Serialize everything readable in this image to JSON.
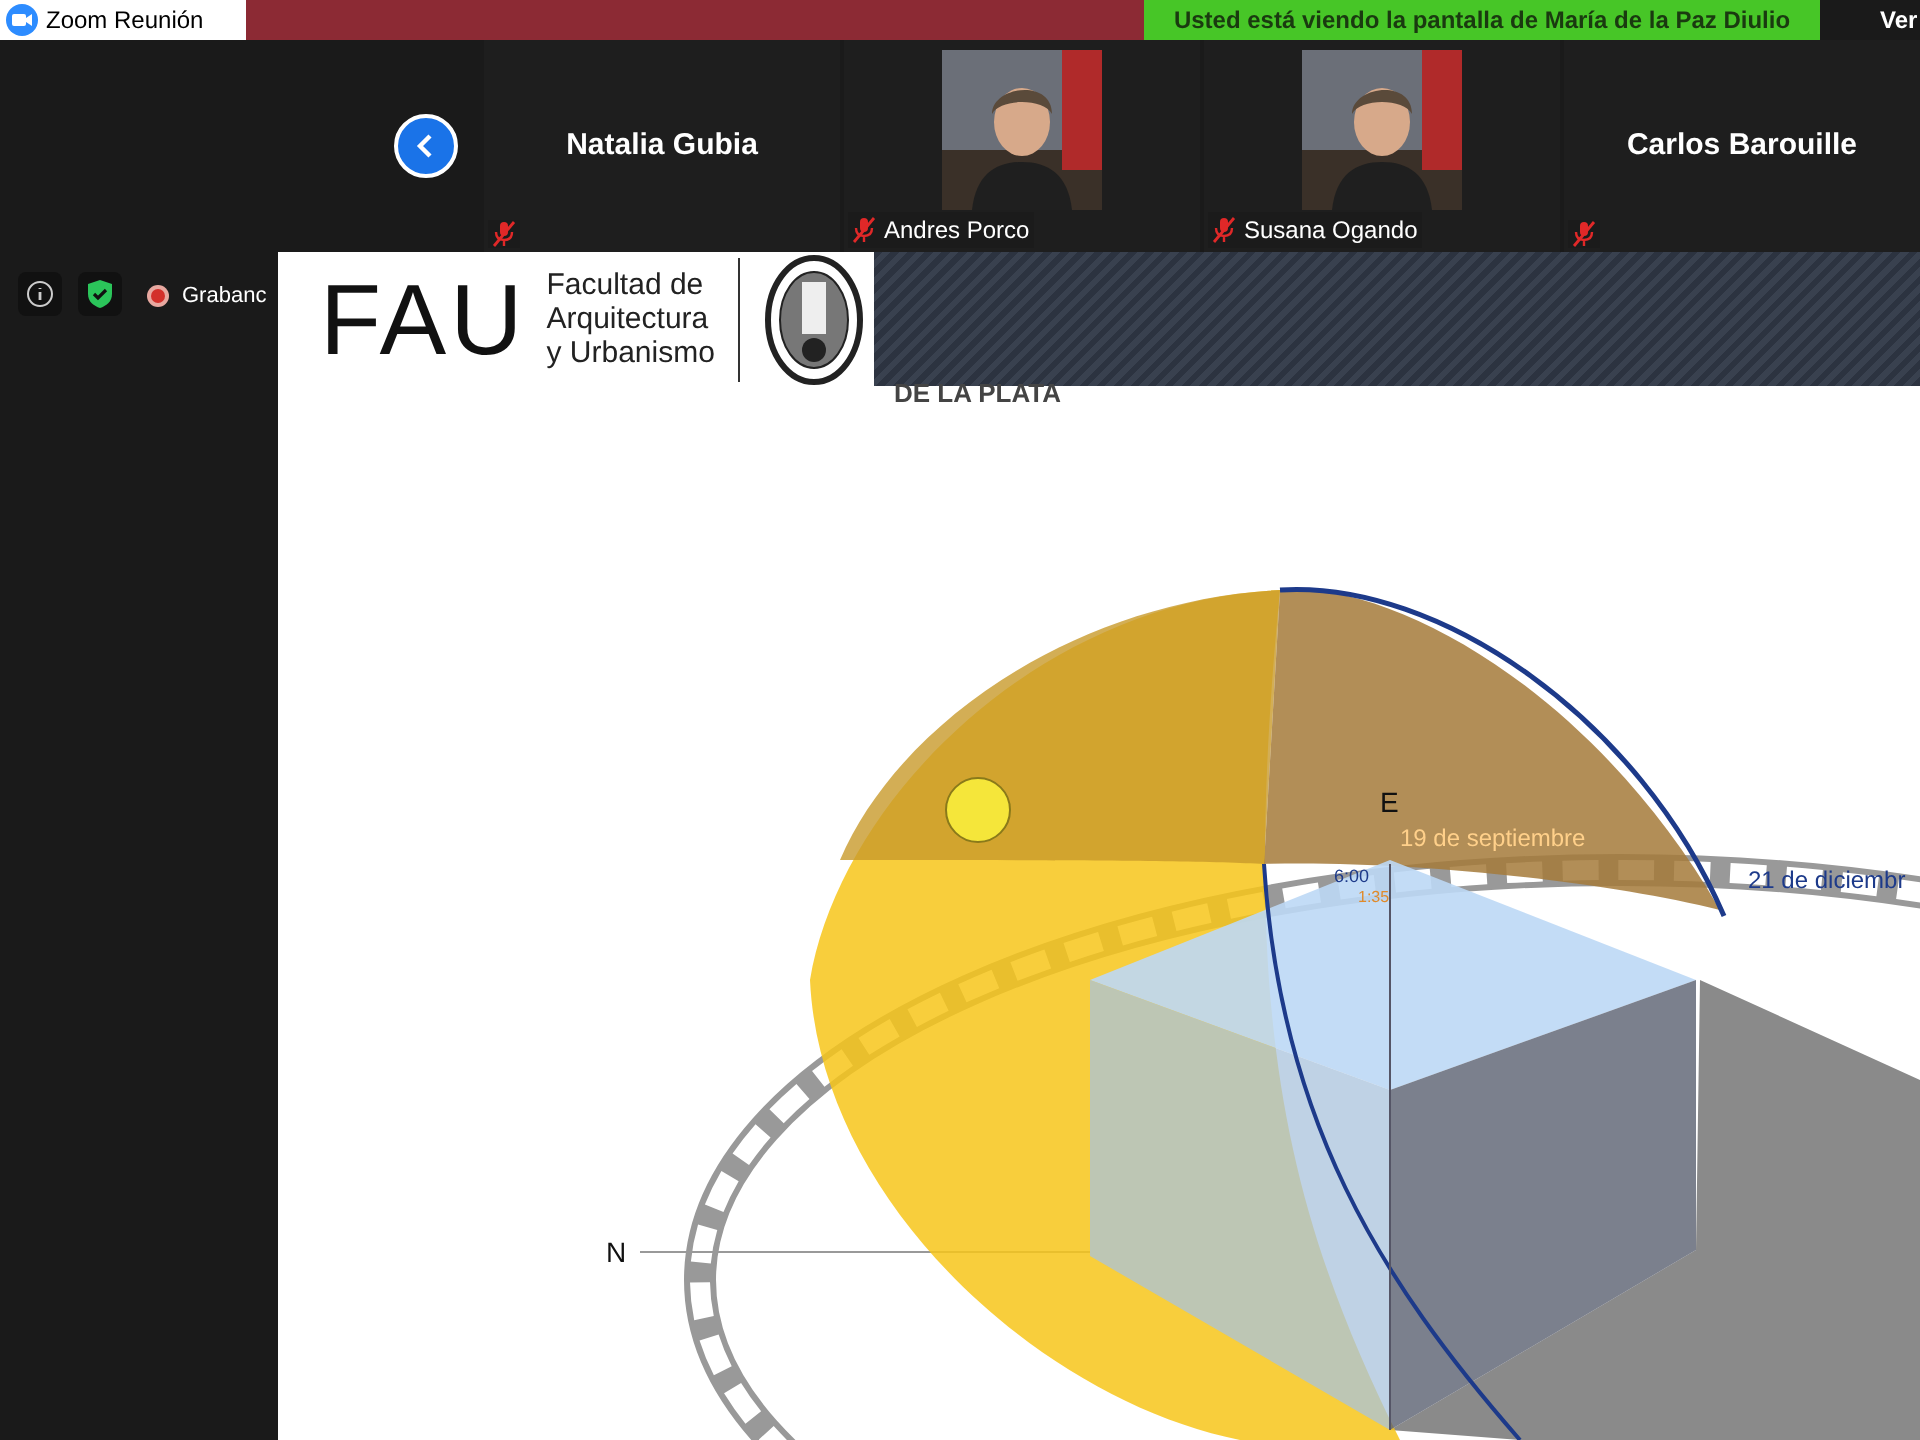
{
  "window": {
    "title": "Zoom Reunión"
  },
  "banner": "Usted está viendo la pantalla de María de la Paz Diulio",
  "view_button": "Ver",
  "participants": [
    {
      "name": "Natalia Gubia",
      "kind": "name",
      "muted": true
    },
    {
      "name": "Andres Porco",
      "kind": "video",
      "muted": true
    },
    {
      "name": "Susana Ogando",
      "kind": "video",
      "muted": true
    },
    {
      "name": "Carlos Barouille",
      "kind": "name",
      "muted": true
    }
  ],
  "meeting_status": {
    "recording": "Grabanc"
  },
  "slide": {
    "logo": {
      "mark": "FAU",
      "lines": [
        "Facultad de",
        "Arquitectura",
        "y Urbanismo"
      ],
      "university": "DE LA PLATA"
    },
    "diagram_labels": {
      "east": "E",
      "north": "N",
      "date_1": "19 de septiembre",
      "time": "6:00",
      "time_2": "1:35",
      "date_2": "21 de diciembr"
    }
  }
}
